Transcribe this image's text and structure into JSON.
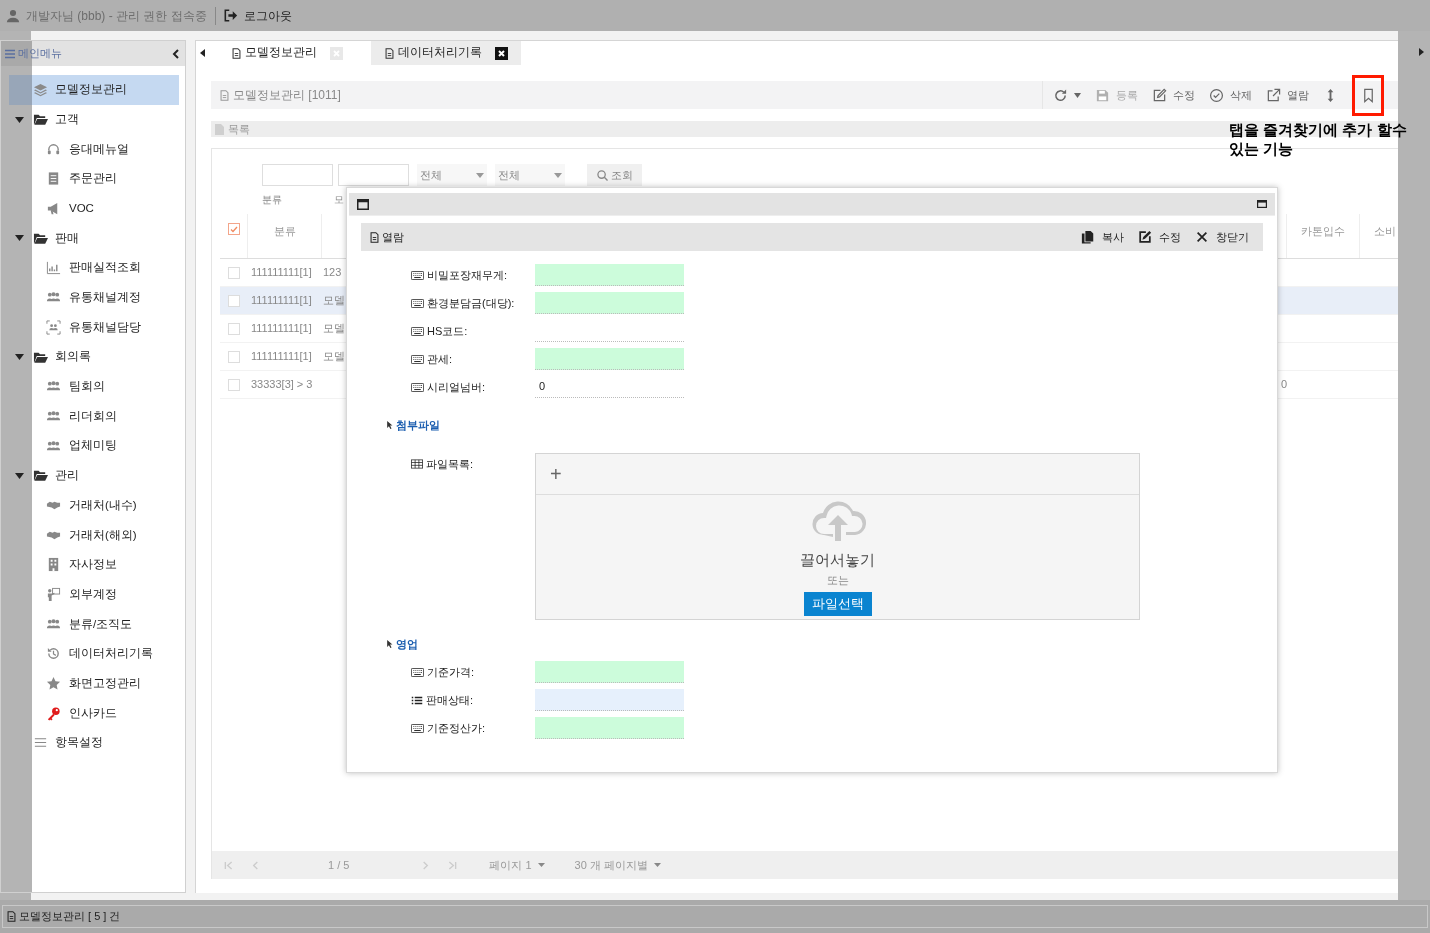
{
  "top_bar": {
    "user": "개발자님 (bbb) - 관리 권한 접속중",
    "logout": "로그아웃"
  },
  "sidebar": {
    "title": "메인메뉴",
    "items": [
      {
        "label": "모델정보관리",
        "selected": true
      },
      {
        "label": "고객",
        "selected": false,
        "expanded": true,
        "children": [
          {
            "label": "응대메뉴얼",
            "selected": false
          },
          {
            "label": "주문관리",
            "selected": false
          },
          {
            "label": "VOC",
            "selected": false
          }
        ]
      },
      {
        "label": "판매",
        "selected": false,
        "expanded": true,
        "children": [
          {
            "label": "판매실적조회",
            "selected": false
          },
          {
            "label": "유통채널계정",
            "selected": false
          },
          {
            "label": "유통채널담당",
            "selected": false
          }
        ]
      },
      {
        "label": "회의록",
        "selected": false,
        "expanded": true,
        "children": [
          {
            "label": "팀회의",
            "selected": false
          },
          {
            "label": "리더회의",
            "selected": false
          },
          {
            "label": "업체미팅",
            "selected": false
          }
        ]
      },
      {
        "label": "관리",
        "selected": false,
        "expanded": true,
        "children": [
          {
            "label": "거래처(내수)",
            "selected": false
          },
          {
            "label": "거래처(해외)",
            "selected": false
          },
          {
            "label": "자사정보",
            "selected": false
          },
          {
            "label": "외부계정",
            "selected": false
          },
          {
            "label": "분류/조직도",
            "selected": false
          },
          {
            "label": "데이터처리기록",
            "selected": false
          },
          {
            "label": "화면고정관리",
            "selected": false
          },
          {
            "label": "인사카드",
            "selected": false
          }
        ]
      },
      {
        "label": "항목설정",
        "selected": false
      }
    ]
  },
  "tabs": [
    {
      "label": "모델정보관리",
      "selected": true
    },
    {
      "label": "데이터처리기록",
      "selected": false
    }
  ],
  "page_header": {
    "title": "모델정보관리 [1011]",
    "toolbar": [
      {
        "kind": "refresh"
      },
      {
        "kind": "save",
        "label": "등록",
        "disabled": true
      },
      {
        "kind": "edit",
        "label": "수정",
        "disabled": false
      },
      {
        "kind": "delete",
        "label": "삭제",
        "disabled": false
      },
      {
        "kind": "view",
        "label": "열람",
        "disabled": false
      },
      {
        "kind": "resize"
      },
      {
        "kind": "bookmark",
        "highlighted": true
      }
    ]
  },
  "annotation": [
    "탭을 즐겨찾기에 추가 할수",
    "있는 기능"
  ],
  "list_section": {
    "title": "목록"
  },
  "filters": {
    "fields": [
      {
        "kind": "input"
      },
      {
        "kind": "input"
      },
      {
        "kind": "select",
        "value": "전체"
      },
      {
        "kind": "select",
        "value": "전체"
      }
    ],
    "labels": [
      "분류",
      "모"
    ],
    "search_button": "조회"
  },
  "table": {
    "select_all": {
      "checked": true
    },
    "columns_left": [
      "분류"
    ],
    "columns_right": [
      "카톤입수",
      "소비"
    ],
    "rows": [
      {
        "checked": false,
        "selected": false,
        "cells": [
          "111111111[1]",
          "123"
        ]
      },
      {
        "checked": false,
        "selected": true,
        "cells": [
          "111111111[1]",
          "모델"
        ]
      },
      {
        "checked": false,
        "selected": false,
        "cells": [
          "111111111[1]",
          "모델"
        ]
      },
      {
        "checked": false,
        "selected": false,
        "cells": [
          "111111111[1]",
          "모델"
        ]
      },
      {
        "checked": false,
        "selected": false,
        "cells": [
          "33333[3] > 3"
        ],
        "tail": "0"
      }
    ]
  },
  "pagination": {
    "page_info": "1 / 5",
    "page": "페이지 1",
    "per_page": "30 개 페이지별"
  },
  "modal": {
    "toolbar_title": "열람",
    "actions": [
      {
        "kind": "copy",
        "label": "복사"
      },
      {
        "kind": "edit",
        "label": "수정"
      },
      {
        "kind": "close",
        "label": "창닫기"
      }
    ],
    "rows": [
      {
        "kind": "text",
        "label": "비밀포장재무게:",
        "color": "#ccfcdb"
      },
      {
        "kind": "text",
        "label": "환경분담금(대당):",
        "color": "#ccfcdb"
      },
      {
        "kind": "text",
        "label": "HS코드:"
      },
      {
        "kind": "text",
        "label": "관세:",
        "color": "#ccfcdb"
      },
      {
        "kind": "text",
        "label": "시리얼넘버:",
        "value": "0"
      },
      {
        "kind": "section",
        "title": "첨부파일"
      },
      {
        "kind": "files",
        "label": "파일목록:",
        "add": "+",
        "drop_text": "끌어서놓기",
        "or_text": "또는",
        "button": "파일선택"
      },
      {
        "kind": "section",
        "title": "영업"
      },
      {
        "kind": "text",
        "label": "기준가격:",
        "color": "#ccfcdb"
      },
      {
        "kind": "select",
        "label": "판매상태:",
        "color": "#e6f0fc"
      },
      {
        "kind": "text",
        "label": "기준정산가:",
        "color": "#ccfcdb"
      }
    ]
  },
  "status_bar": "모델정보관리 [ 5 ] 건"
}
